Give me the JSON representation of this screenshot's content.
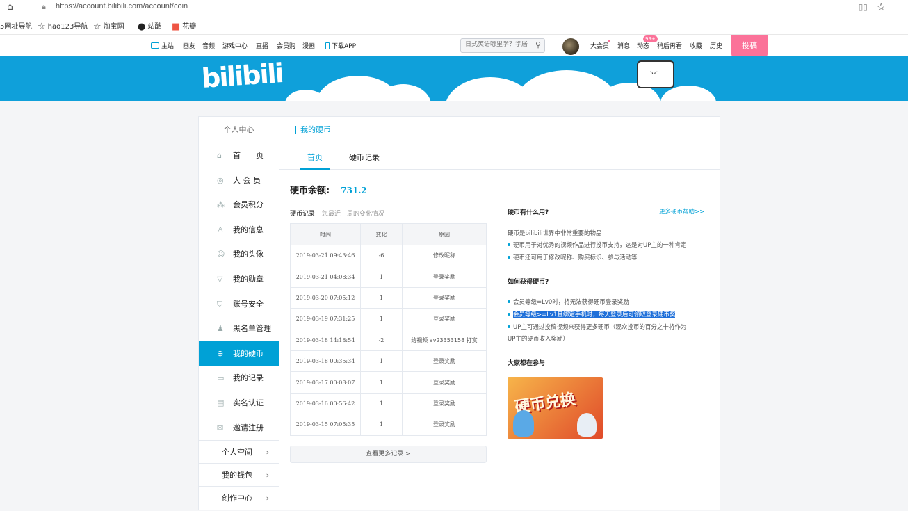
{
  "browser": {
    "url": "https://account.bilibili.com/account/coin",
    "bookmarks": [
      {
        "label": "5网址导航",
        "icon": ""
      },
      {
        "label": "hao123导航",
        "icon": "star-icon"
      },
      {
        "label": "淘宝网",
        "icon": "star-icon"
      },
      {
        "label": "站酷",
        "icon": "zcool-icon"
      },
      {
        "label": "花瓣",
        "icon": "huaban-icon"
      }
    ]
  },
  "topnav": {
    "links": [
      "主站",
      "画友",
      "音频",
      "游戏中心",
      "直播",
      "会员购",
      "漫画",
      "下载APP"
    ],
    "search_placeholder": "日式英语哪里学？学居",
    "user_links": [
      "大会员",
      "消息",
      "动态",
      "稍后再看",
      "收藏",
      "历史"
    ],
    "dynamic_badge": "99+",
    "upload_label": "投稿"
  },
  "sidebar": {
    "title": "个人中心",
    "items": [
      {
        "label": "首　　页",
        "icon": "home-icon"
      },
      {
        "label": "大 会 员",
        "icon": "vip-icon"
      },
      {
        "label": "会员积分",
        "icon": "points-icon"
      },
      {
        "label": "我的信息",
        "icon": "user-icon"
      },
      {
        "label": "我的头像",
        "icon": "avatar-icon"
      },
      {
        "label": "我的勋章",
        "icon": "medal-icon"
      },
      {
        "label": "账号安全",
        "icon": "shield-icon"
      },
      {
        "label": "黑名单管理",
        "icon": "blacklist-icon"
      },
      {
        "label": "我的硬币",
        "icon": "coin-icon"
      },
      {
        "label": "我的记录",
        "icon": "record-icon"
      },
      {
        "label": "实名认证",
        "icon": "id-card-icon"
      },
      {
        "label": "邀请注册",
        "icon": "invite-icon"
      }
    ],
    "active_index": 8,
    "groups": [
      "个人空间",
      "我的钱包",
      "创作中心"
    ]
  },
  "content": {
    "title": "我的硬币",
    "tabs": [
      "首页",
      "硬币记录"
    ],
    "balance_label": "硬币余额:",
    "balance_value": "731.2",
    "records_label": "硬币记录",
    "records_sub": "您最近一周的变化情况",
    "table_headers": [
      "时间",
      "变化",
      "原因"
    ],
    "rows": [
      [
        "2019-03-21 09:43:46",
        "-6",
        "修改昵称"
      ],
      [
        "2019-03-21 04:08:34",
        "1",
        "登录奖励"
      ],
      [
        "2019-03-20 07:05:12",
        "1",
        "登录奖励"
      ],
      [
        "2019-03-19 07:31:25",
        "1",
        "登录奖励"
      ],
      [
        "2019-03-18 14:18:54",
        "-2",
        "给视频 av23353158 打赏"
      ],
      [
        "2019-03-18 00:35:34",
        "1",
        "登录奖励"
      ],
      [
        "2019-03-17 00:08:07",
        "1",
        "登录奖励"
      ],
      [
        "2019-03-16 00:56:42",
        "1",
        "登录奖励"
      ],
      [
        "2019-03-15 07:05:35",
        "1",
        "登录奖励"
      ]
    ],
    "more_label": "查看更多记录 >",
    "right": {
      "use_title": "硬币有什么用?",
      "help_link": "更多硬币帮助>>",
      "use_intro": "硬币是bilibili世界中非常重要的物品",
      "use_points": [
        "硬币用于对优秀的视频作品进行投币支持，这是对UP主的一种肯定",
        "硬币还可用于修改昵称、购买标识、参与活动等"
      ],
      "get_title": "如何获得硬币?",
      "get_points": [
        "会员等级=Lv0时，将无法获得硬币登录奖励",
        "会员等级>=Lv1且绑定手机时，每天登录后可领取登录硬币奖",
        "UP主可通过投稿视频来获得更多硬币（观众投币的百分之十将作为",
        "UP主的硬币收入奖励）"
      ],
      "join_title": "大家都在参与",
      "promo_text": "硬币兑换"
    }
  }
}
